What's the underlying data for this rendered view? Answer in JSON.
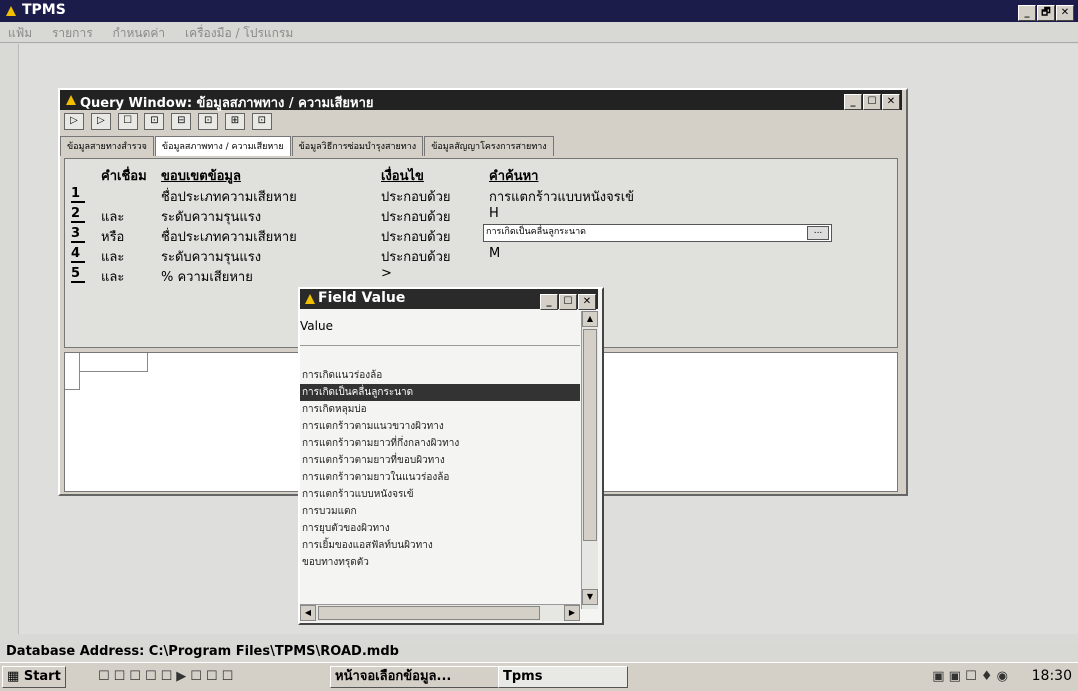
{
  "app": {
    "title": "TPMS",
    "menu": [
      "แฟ้ม",
      "รายการ",
      "กำหนดค่า",
      "เครื่องมือ / โปรแกรม"
    ],
    "min": "_",
    "max": "🗗",
    "close": "✕"
  },
  "query_window": {
    "title": "Query Window: ข้อมูลสภาพทาง / ความเสียหาย",
    "toolbar": [
      "▷",
      "▷",
      "☐",
      "⊡",
      "⊟",
      "⊡",
      "⊞",
      "⊡"
    ],
    "tabs": [
      "ข้อมูลสายทางสำรวจ",
      "ข้อมูลสภาพทาง / ความเสียหาย",
      "ข้อมูลวิธีการซ่อมบำรุงสายทาง",
      "ข้อมูลสัญญาโครงการสายทาง"
    ],
    "headers": {
      "conj": "คำเชื่อม",
      "field": "ขอบเขตข้อมูล",
      "cond": "เงื่อนไข",
      "search": "คำค้นหา"
    },
    "rows": [
      {
        "n": "1",
        "conj": "",
        "field": "ชื่อประเภทความเสียหาย",
        "cond": "ประกอบด้วย",
        "value": "การแตกร้าวแบบหนังจรเข้"
      },
      {
        "n": "2",
        "conj": "และ",
        "field": "ระดับความรุนแรง",
        "cond": "ประกอบด้วย",
        "value": "H"
      },
      {
        "n": "3",
        "conj": "หรือ",
        "field": "ชื่อประเภทความเสียหาย",
        "cond": "ประกอบด้วย",
        "value": "การเกิดเป็นคลื่นลูกระนาด"
      },
      {
        "n": "4",
        "conj": "และ",
        "field": "ระดับความรุนแรง",
        "cond": "ประกอบด้วย",
        "value": "M"
      },
      {
        "n": "5",
        "conj": "และ",
        "field": "% ความเสียหาย",
        "cond": ">",
        "value": ""
      }
    ],
    "dots": "..."
  },
  "field_value": {
    "title": "Field Value",
    "header": "Value",
    "items": [
      "การเกิดแนวร่องล้อ",
      "การเกิดเป็นคลื่นลูกระนาด",
      "การเกิดหลุมบ่อ",
      "การแตกร้าวตามแนวขวางผิวทาง",
      "การแตกร้าวตามยาวที่กึ่งกลางผิวทาง",
      "การแตกร้าวตามยาวที่ขอบผิวทาง",
      "การแตกร้าวตามยาวในแนวร่องล้อ",
      "การแตกร้าวแบบหนังจรเข้",
      "การบวมแตก",
      "การยุบตัวของผิวทาง",
      "การเยิ้มของแอสฟัลท์บนผิวทาง",
      "ขอบทางทรุดตัว"
    ],
    "selected_index": 1
  },
  "status": {
    "text": "Database Address: C:\\Program Files\\TPMS\\ROAD.mdb"
  },
  "taskbar": {
    "start": "Start",
    "tasks": [
      "หน้าจอเลือกข้อมูล...",
      "Tpms"
    ],
    "clock": "18:30"
  }
}
